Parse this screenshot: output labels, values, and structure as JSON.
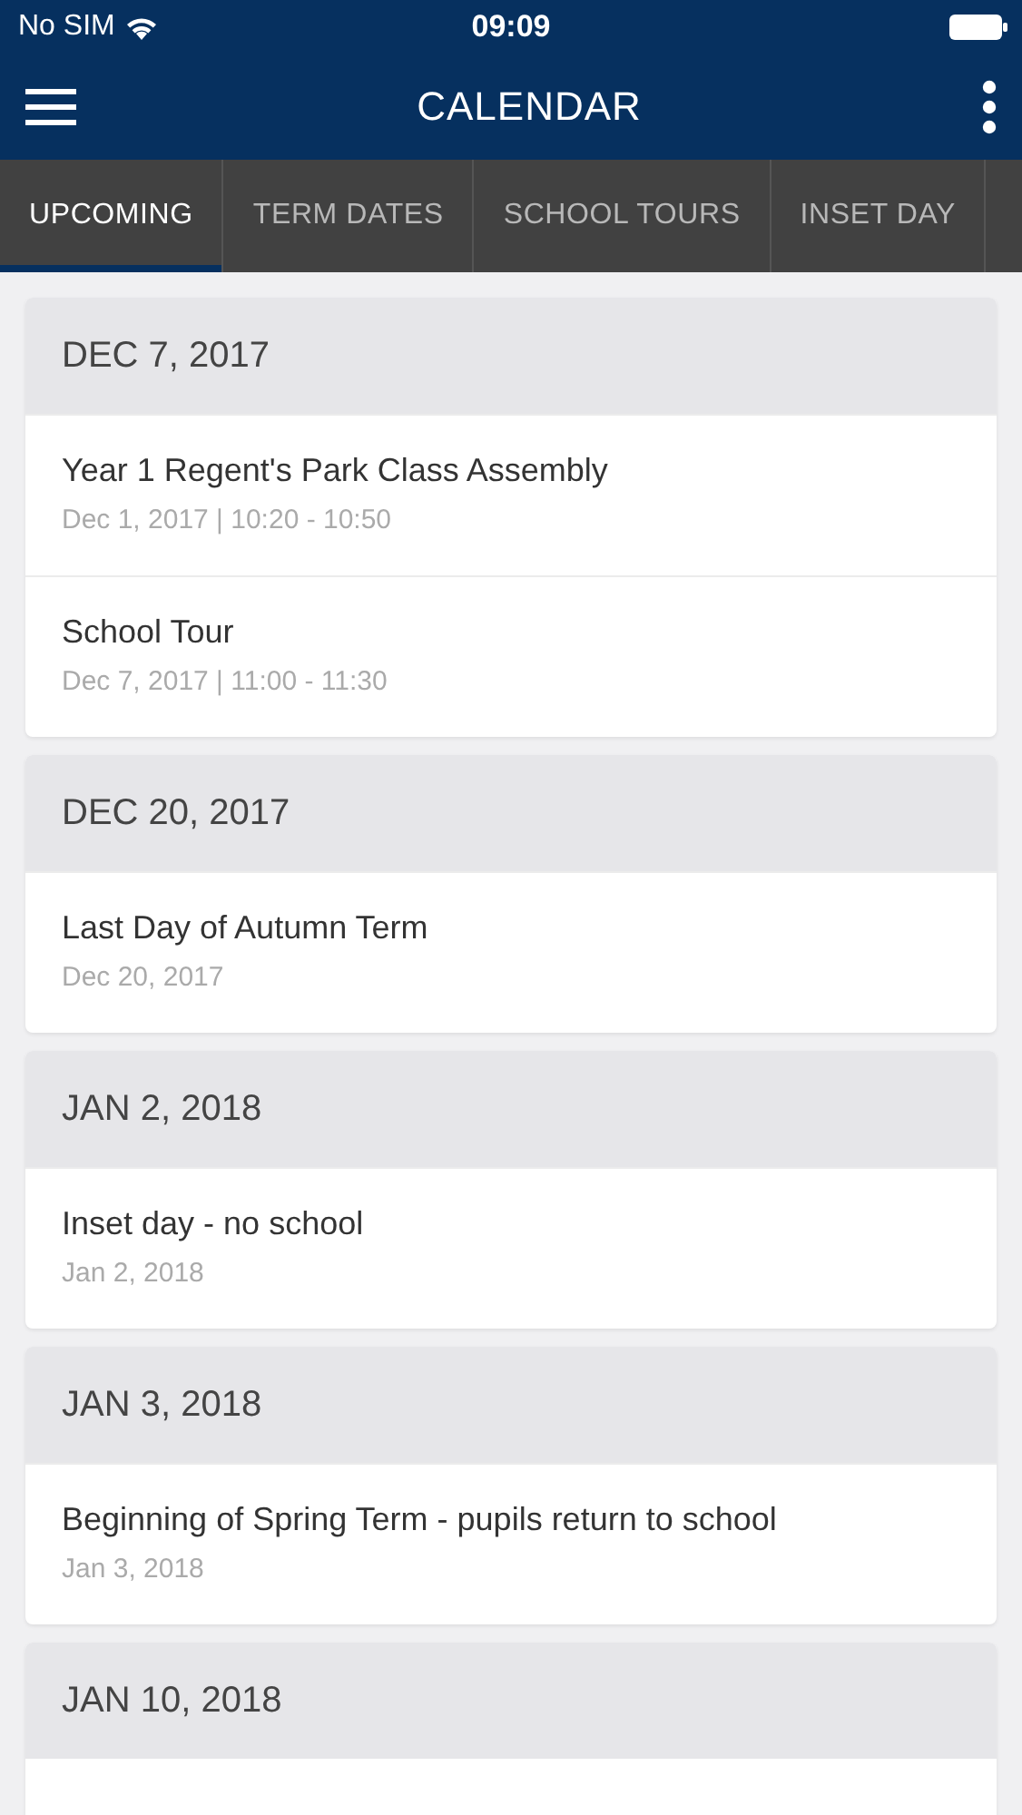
{
  "status_bar": {
    "carrier": "No SIM",
    "time": "09:09"
  },
  "header": {
    "title": "CALENDAR"
  },
  "tabs": [
    {
      "label": "UPCOMING",
      "selected": true
    },
    {
      "label": "TERM DATES",
      "selected": false
    },
    {
      "label": "SCHOOL TOURS",
      "selected": false
    },
    {
      "label": "INSET DAY",
      "selected": false
    }
  ],
  "groups": [
    {
      "date": "DEC 7, 2017",
      "events": [
        {
          "title": "Year 1 Regent's Park Class Assembly",
          "when": "Dec 1, 2017 | 10:20 - 10:50"
        },
        {
          "title": "School Tour",
          "when": "Dec 7, 2017 | 11:00 - 11:30"
        }
      ]
    },
    {
      "date": "DEC 20, 2017",
      "events": [
        {
          "title": "Last Day of Autumn Term",
          "when": "Dec 20, 2017"
        }
      ]
    },
    {
      "date": "JAN 2, 2018",
      "events": [
        {
          "title": "Inset day - no school",
          "when": "Jan 2, 2018"
        }
      ]
    },
    {
      "date": "JAN 3, 2018",
      "events": [
        {
          "title": "Beginning of Spring Term - pupils return to school",
          "when": "Jan 3, 2018"
        }
      ]
    },
    {
      "date": "JAN 10, 2018"
    }
  ]
}
